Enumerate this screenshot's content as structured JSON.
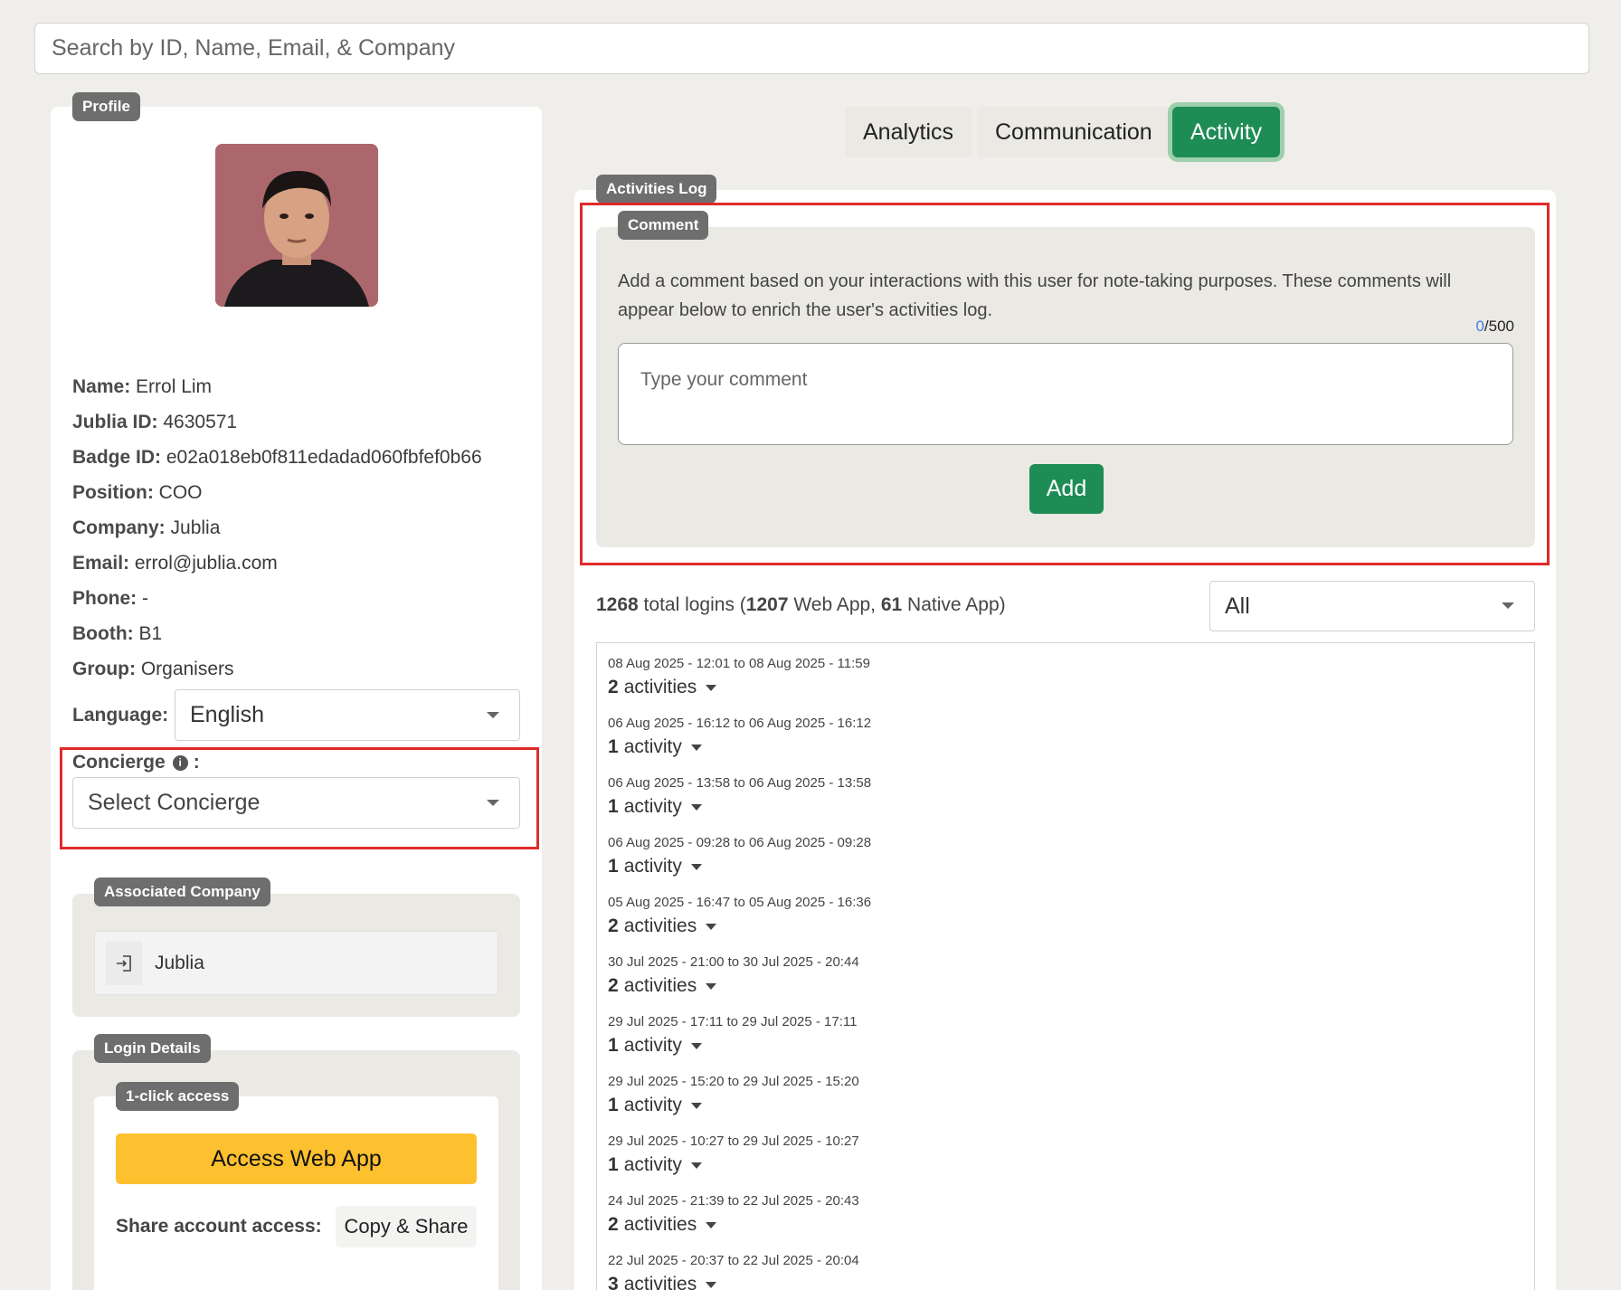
{
  "search": {
    "placeholder": "Search by ID, Name, Email, & Company"
  },
  "profile": {
    "tag": "Profile",
    "rows": [
      {
        "label": "Name:",
        "value": " Errol Lim"
      },
      {
        "label": "Jublia ID:",
        "value": " 4630571"
      },
      {
        "label": "Badge ID:",
        "value": " e02a018eb0f811edadad060fbfef0b66"
      },
      {
        "label": "Position:",
        "value": " COO"
      },
      {
        "label": "Company:",
        "value": " Jublia"
      },
      {
        "label": "Email:",
        "value": " errol@jublia.com"
      },
      {
        "label": "Phone:",
        "value": " -"
      },
      {
        "label": "Booth:",
        "value": " B1"
      },
      {
        "label": "Group:",
        "value": " Organisers"
      }
    ],
    "language_label": "Language:",
    "language_value": "English",
    "concierge_label": "Concierge",
    "concierge_colon": ":",
    "concierge_placeholder": "Select Concierge"
  },
  "associated_company": {
    "tag": "Associated Company",
    "name": "Jublia"
  },
  "login_details": {
    "tag": "Login Details",
    "one_click_tag": "1-click access",
    "access_button": "Access Web App",
    "share_label": "Share account access:",
    "share_button": "Copy & Share"
  },
  "tabs": [
    {
      "label": "Analytics"
    },
    {
      "label": "Communication"
    },
    {
      "label": "Activity"
    }
  ],
  "activities_log": {
    "tag": "Activities Log",
    "comment_tag": "Comment",
    "comment_desc_1": "Add a comment based on your interactions with this user for note-taking purposes. These comments will",
    "comment_desc_2": "appear below to enrich the user's activities log.",
    "char_count": "0",
    "char_max": "/500",
    "comment_placeholder": "Type your comment",
    "add_button": "Add",
    "total_logins": "1268",
    "total_text": " total logins (",
    "web_count": "1207",
    "web_text": " Web App, ",
    "native_count": "61",
    "native_text": " Native App)",
    "filter_value": "All"
  },
  "log_entries": [
    {
      "date": "08 Aug 2025 - 12:01 to 08 Aug 2025 - 11:59",
      "count": "2",
      "unit": "activities"
    },
    {
      "date": "06 Aug 2025 - 16:12 to 06 Aug 2025 - 16:12",
      "count": "1",
      "unit": "activity"
    },
    {
      "date": "06 Aug 2025 - 13:58 to 06 Aug 2025 - 13:58",
      "count": "1",
      "unit": "activity"
    },
    {
      "date": "06 Aug 2025 - 09:28 to 06 Aug 2025 - 09:28",
      "count": "1",
      "unit": "activity"
    },
    {
      "date": "05 Aug 2025 - 16:47 to 05 Aug 2025 - 16:36",
      "count": "2",
      "unit": "activities"
    },
    {
      "date": "30 Jul 2025 - 21:00 to 30 Jul 2025 - 20:44",
      "count": "2",
      "unit": "activities"
    },
    {
      "date": "29 Jul 2025 - 17:11 to 29 Jul 2025 - 17:11",
      "count": "1",
      "unit": "activity"
    },
    {
      "date": "29 Jul 2025 - 15:20 to 29 Jul 2025 - 15:20",
      "count": "1",
      "unit": "activity"
    },
    {
      "date": "29 Jul 2025 - 10:27 to 29 Jul 2025 - 10:27",
      "count": "1",
      "unit": "activity"
    },
    {
      "date": "24 Jul 2025 - 21:39 to 22 Jul 2025 - 20:43",
      "count": "2",
      "unit": "activities"
    },
    {
      "date": "22 Jul 2025 - 20:37 to 22 Jul 2025 - 20:04",
      "count": "3",
      "unit": "activities"
    }
  ],
  "colors": {
    "accent": "#1e8c55",
    "highlight": "#e02a2a",
    "cta": "#fdc02f",
    "link": "#3d7fe0"
  }
}
